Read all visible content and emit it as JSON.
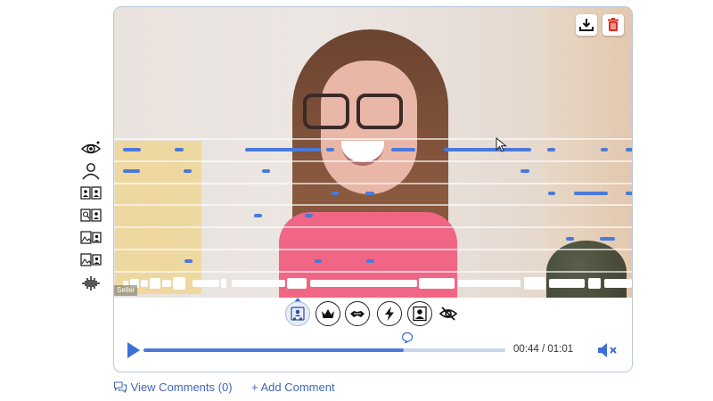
{
  "overlay": {
    "watermark": "Seller"
  },
  "toolbar": {
    "download_icon": "download-icon",
    "delete_icon": "trash-icon"
  },
  "categories": [
    {
      "icon": "meeting-participants-icon",
      "active": true
    },
    {
      "icon": "crown-icon",
      "active": false
    },
    {
      "icon": "handshake-icon",
      "active": false
    },
    {
      "icon": "lightning-icon",
      "active": false
    },
    {
      "icon": "person-portrait-icon",
      "active": false
    },
    {
      "icon": "eye-slash-icon",
      "active": false
    }
  ],
  "rows": [
    {
      "icon": "eye-icon"
    },
    {
      "icon": "person-icon"
    },
    {
      "icon": "presenter-pair-icon"
    },
    {
      "icon": "search-person-icon"
    },
    {
      "icon": "image-person-icon"
    },
    {
      "icon": "image-person-icon"
    },
    {
      "icon": "audio-waveform-icon"
    }
  ],
  "player": {
    "time": "00:44 / 01:01",
    "current_seconds": 44,
    "duration_seconds": 61,
    "progress_fraction": 0.72
  },
  "footer": {
    "view_comments": "View Comments (0)",
    "add_comment": "+ Add Comment"
  },
  "colors": {
    "accent": "#3d6fd8",
    "highlight": "#f0d06e",
    "delete": "#d93025"
  }
}
